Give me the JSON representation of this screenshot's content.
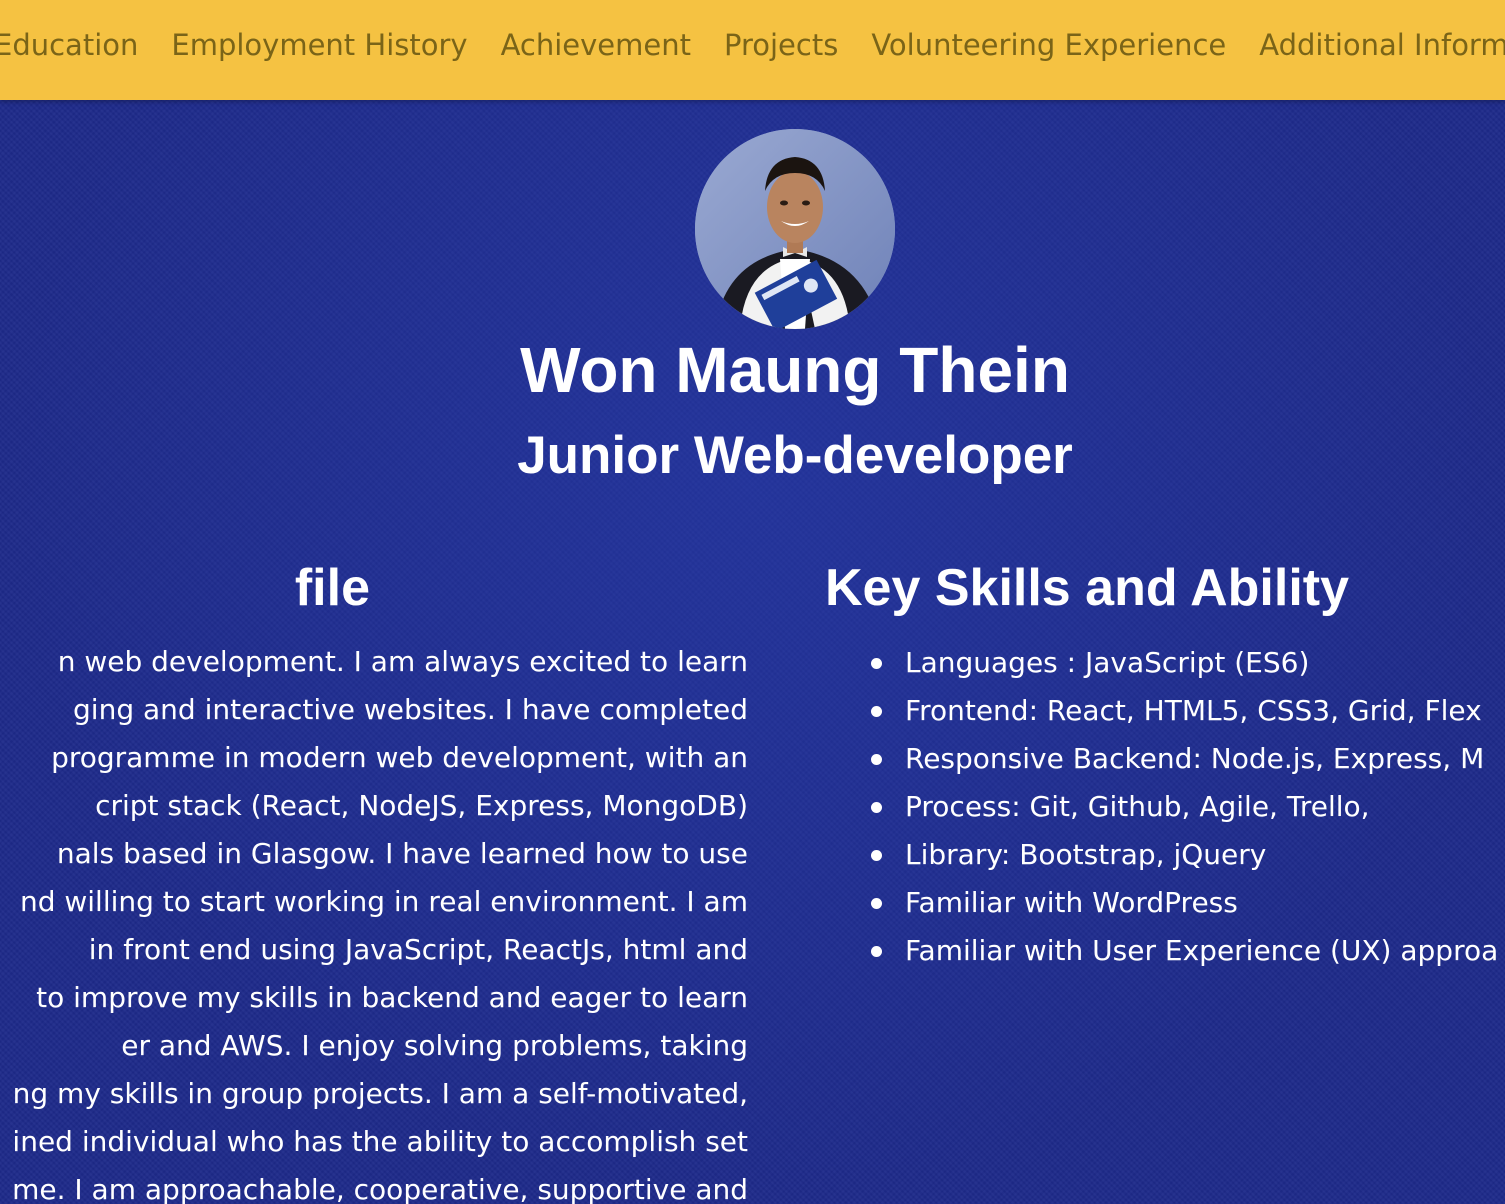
{
  "nav": {
    "items": [
      "Education",
      "Employment History",
      "Achievement",
      "Projects",
      "Volunteering Experience",
      "Additional Informa"
    ]
  },
  "header": {
    "name": "Won Maung Thein",
    "role": "Junior Web-developer",
    "avatar_icon": "profile-photo"
  },
  "profile": {
    "heading": "file",
    "lines": [
      "n web development. I am always excited to learn",
      "ging and interactive websites. I have completed",
      "programme in modern web development, with an",
      "cript stack (React, NodeJS, Express, MongoDB)",
      "nals based in Glasgow. I have learned how to use",
      "nd willing to start working in real environment. I am",
      " in front end using JavaScript, ReactJs, html and",
      "to improve my skills in backend and eager to learn",
      "er and AWS. I enjoy solving problems, taking",
      "ng my skills in group projects. I am a self-motivated,",
      "ined individual who has the ability to accomplish set",
      "me. I am approachable, cooperative, supportive and"
    ]
  },
  "skills": {
    "heading": "Key Skills and Ability",
    "items": [
      "Languages : JavaScript (ES6)",
      "Frontend: React, HTML5, CSS3, Grid, Flex",
      "Responsive Backend: Node.js, Express, M",
      "Process: Git, Github, Agile, Trello,",
      "Library: Bootstrap, jQuery",
      "Familiar with WordPress",
      "Familiar with User Experience (UX) approa"
    ]
  },
  "colors": {
    "nav_background": "#f5c242",
    "nav_text": "#7a6418",
    "page_background": "#1e2a8a",
    "text": "#ffffff"
  }
}
